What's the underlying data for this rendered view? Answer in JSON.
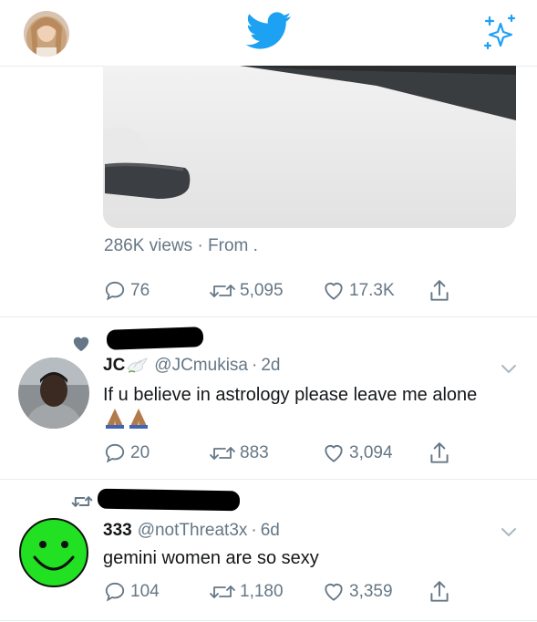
{
  "colors": {
    "twitter_blue": "#1da1f2",
    "secondary_text": "#657786",
    "primary_text": "#14171a",
    "divider": "#e6ecf0",
    "smiley_green": "#22e022"
  },
  "header": {
    "profile_icon": "avatar",
    "logo_icon": "twitter-bird-icon",
    "right_icon": "sparkle-icon"
  },
  "top_tweet": {
    "views_text": "286K views · From .",
    "replies": "76",
    "retweets": "5,095",
    "likes": "17.3K"
  },
  "tweets": [
    {
      "context_icon": "heart-icon",
      "display_name": "JC",
      "name_emoji": "dove-icon",
      "handle": "@JCmukisa",
      "time": "2d",
      "text": "If u believe in astrology please leave me alone",
      "trailing_emoji": "praying-hands-icon",
      "replies": "20",
      "retweets": "883",
      "likes": "3,094"
    },
    {
      "context_icon": "retweet-icon",
      "display_name": "333",
      "handle": "@notThreat3x",
      "time": "6d",
      "text": "gemini women are so sexy",
      "replies": "104",
      "retweets": "1,180",
      "likes": "3,359"
    }
  ]
}
